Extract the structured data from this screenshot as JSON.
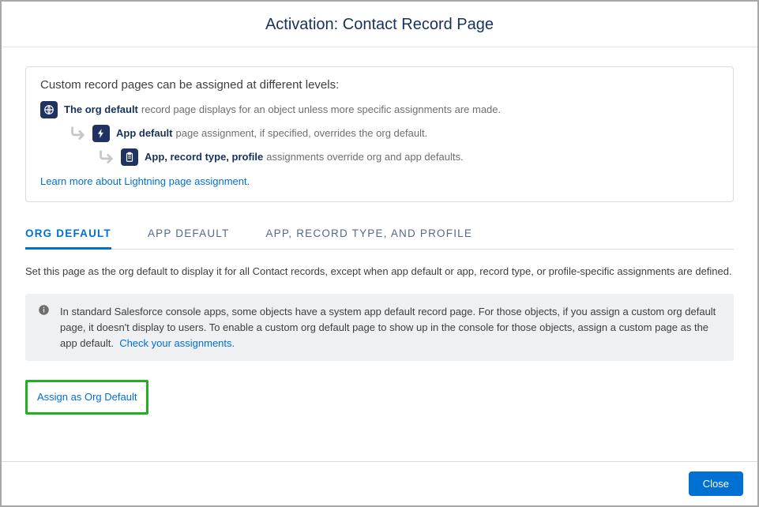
{
  "header": {
    "title": "Activation: Contact Record Page"
  },
  "info_card": {
    "title": "Custom record pages can be assigned at different levels:",
    "levels": [
      {
        "label": "The org default",
        "desc": "record page displays for an object unless more specific assignments are made."
      },
      {
        "label": "App default",
        "desc": "page assignment, if specified, overrides the org default."
      },
      {
        "label": "App, record type, profile",
        "desc": "assignments override org and app defaults."
      }
    ],
    "learn_more": "Learn more about Lightning page assignment."
  },
  "tabs": {
    "items": [
      {
        "label": "ORG DEFAULT",
        "active": true
      },
      {
        "label": "APP DEFAULT",
        "active": false
      },
      {
        "label": "APP, RECORD TYPE, AND PROFILE",
        "active": false
      }
    ]
  },
  "tab_content": {
    "description": "Set this page as the org default to display it for all Contact records, except when app default or app, record type, or profile-specific assignments are defined.",
    "alert": {
      "text": "In standard Salesforce console apps, some objects have a system app default record page. For those objects, if you assign a custom org default page, it doesn't display to users. To enable a custom org default page to show up in the console for those objects, assign a custom page as the app default.",
      "link": "Check your assignments."
    },
    "assign_button": "Assign as Org Default"
  },
  "footer": {
    "close": "Close"
  }
}
